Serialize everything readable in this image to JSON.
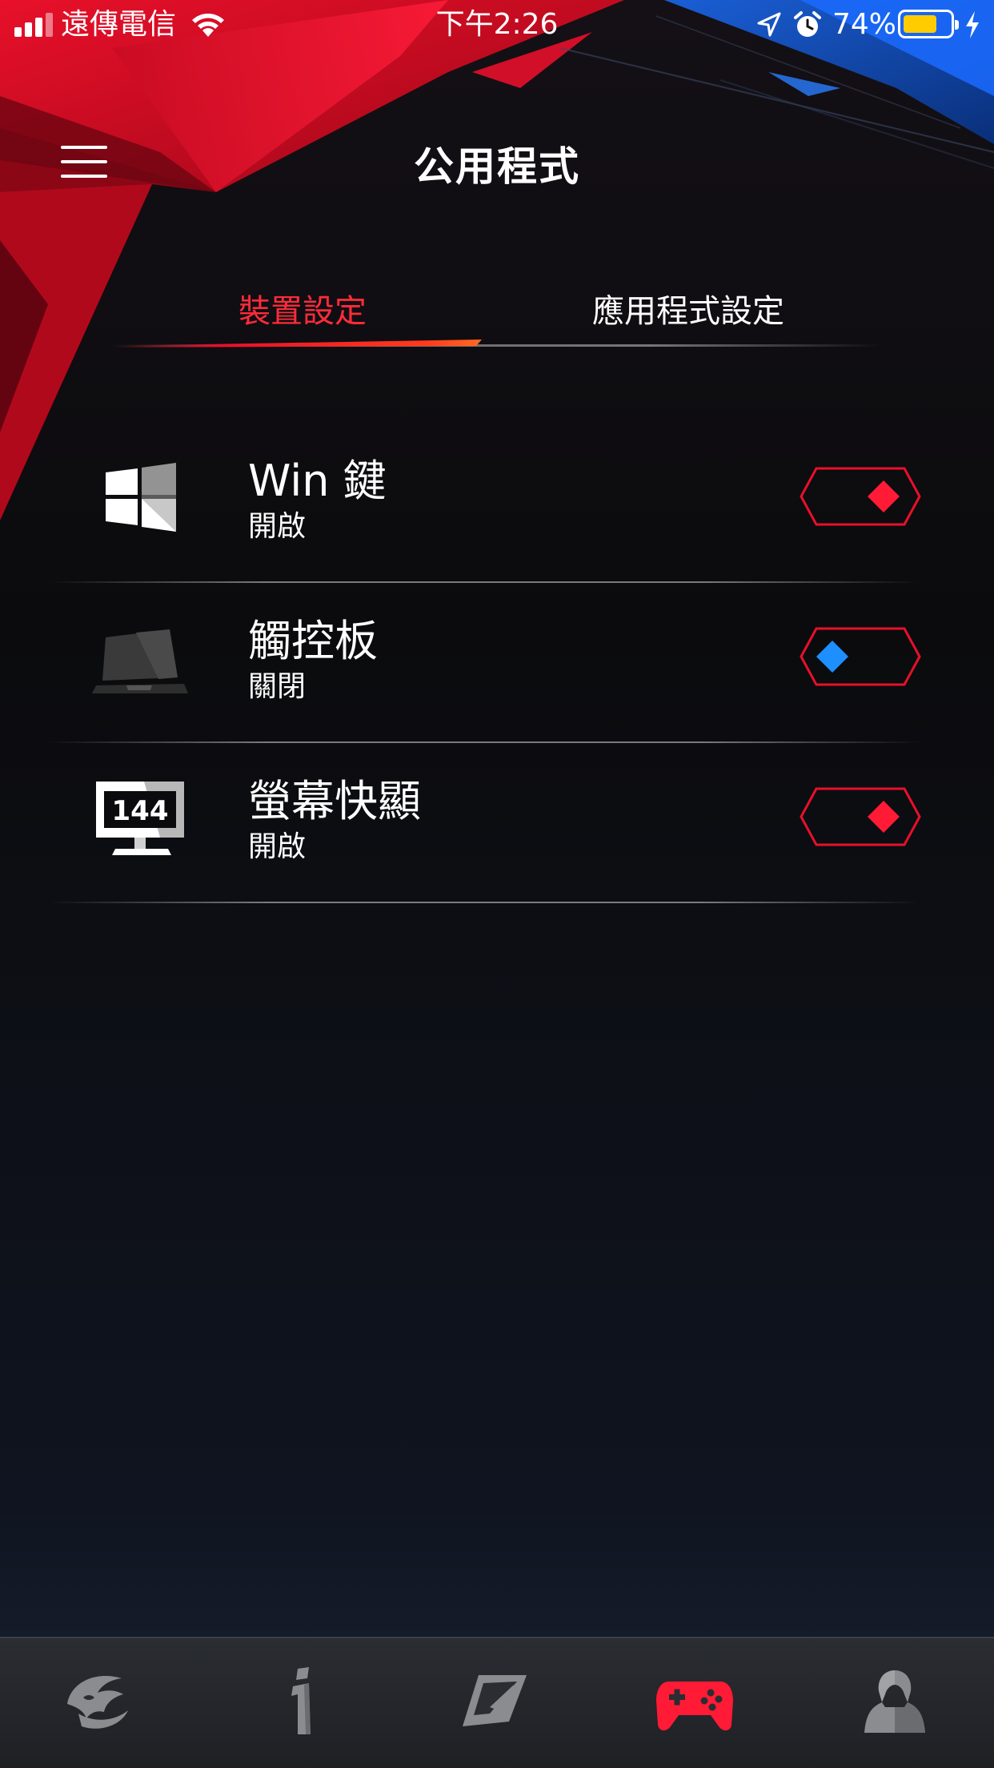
{
  "status_bar": {
    "carrier": "遠傳電信",
    "time": "下午2:26",
    "battery_percent": "74%",
    "battery_level": 0.74,
    "icons": [
      "signal-icon",
      "wifi-icon",
      "location-arrow-icon",
      "alarm-icon",
      "battery-icon",
      "charging-icon"
    ]
  },
  "header": {
    "title": "公用程式",
    "menu_icon": "hamburger-menu-icon"
  },
  "tabs": [
    {
      "label": "裝置設定",
      "active": true
    },
    {
      "label": "應用程式設定",
      "active": false
    }
  ],
  "settings": [
    {
      "label": "Win 鍵",
      "status": "開啟",
      "on": true,
      "icon": "windows-key-icon"
    },
    {
      "label": "觸控板",
      "status": "關閉",
      "on": false,
      "icon": "touchpad-icon"
    },
    {
      "label": "螢幕快顯",
      "status": "開啟",
      "on": true,
      "icon": "monitor-144hz-icon",
      "icon_text": "144"
    }
  ],
  "bottom_nav": [
    {
      "icon": "rog-eye-icon",
      "active": false
    },
    {
      "icon": "info-icon",
      "active": false
    },
    {
      "icon": "display-icon",
      "active": false
    },
    {
      "icon": "gamepad-icon",
      "active": true
    },
    {
      "icon": "user-icon",
      "active": false
    }
  ],
  "colors": {
    "accent_red": "#ff1a35",
    "toggle_on": "#ff1a35",
    "toggle_off": "#1e8fff",
    "tab_active": "#ff2b3a",
    "background": "#0a0a0c"
  }
}
